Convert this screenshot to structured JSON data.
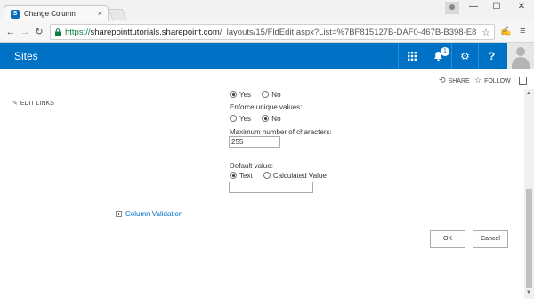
{
  "browser": {
    "tab_title": "Change Column",
    "tab_icon": "S",
    "tab_close": "×",
    "url_scheme": "https://",
    "url_host": "sharepointtutorials.sharepoint.com",
    "url_path": "/_layouts/15/FldEdit.aspx?List=%7BF815127B-DAF0-467B-B398-E88207",
    "win_minimize": "—",
    "win_maximize": "☐",
    "win_close": "✕"
  },
  "suite": {
    "title": "Sites",
    "notification_count": "1",
    "accent_color": "#0072c6"
  },
  "actions": {
    "share": "SHARE",
    "follow": "FOLLOW"
  },
  "nav": {
    "edit_links": "EDIT LINKS"
  },
  "form": {
    "radio_yes": "Yes",
    "radio_no": "No",
    "enforce_label": "Enforce unique values:",
    "enforce_yes": "Yes",
    "enforce_no": "No",
    "max_chars_label": "Maximum number of characters:",
    "max_chars_value": "255",
    "default_label": "Default value:",
    "default_text": "Text",
    "default_calc": "Calculated Value",
    "default_value": "",
    "column_validation": "Column Validation"
  },
  "buttons": {
    "ok": "OK",
    "cancel": "Cancel"
  }
}
